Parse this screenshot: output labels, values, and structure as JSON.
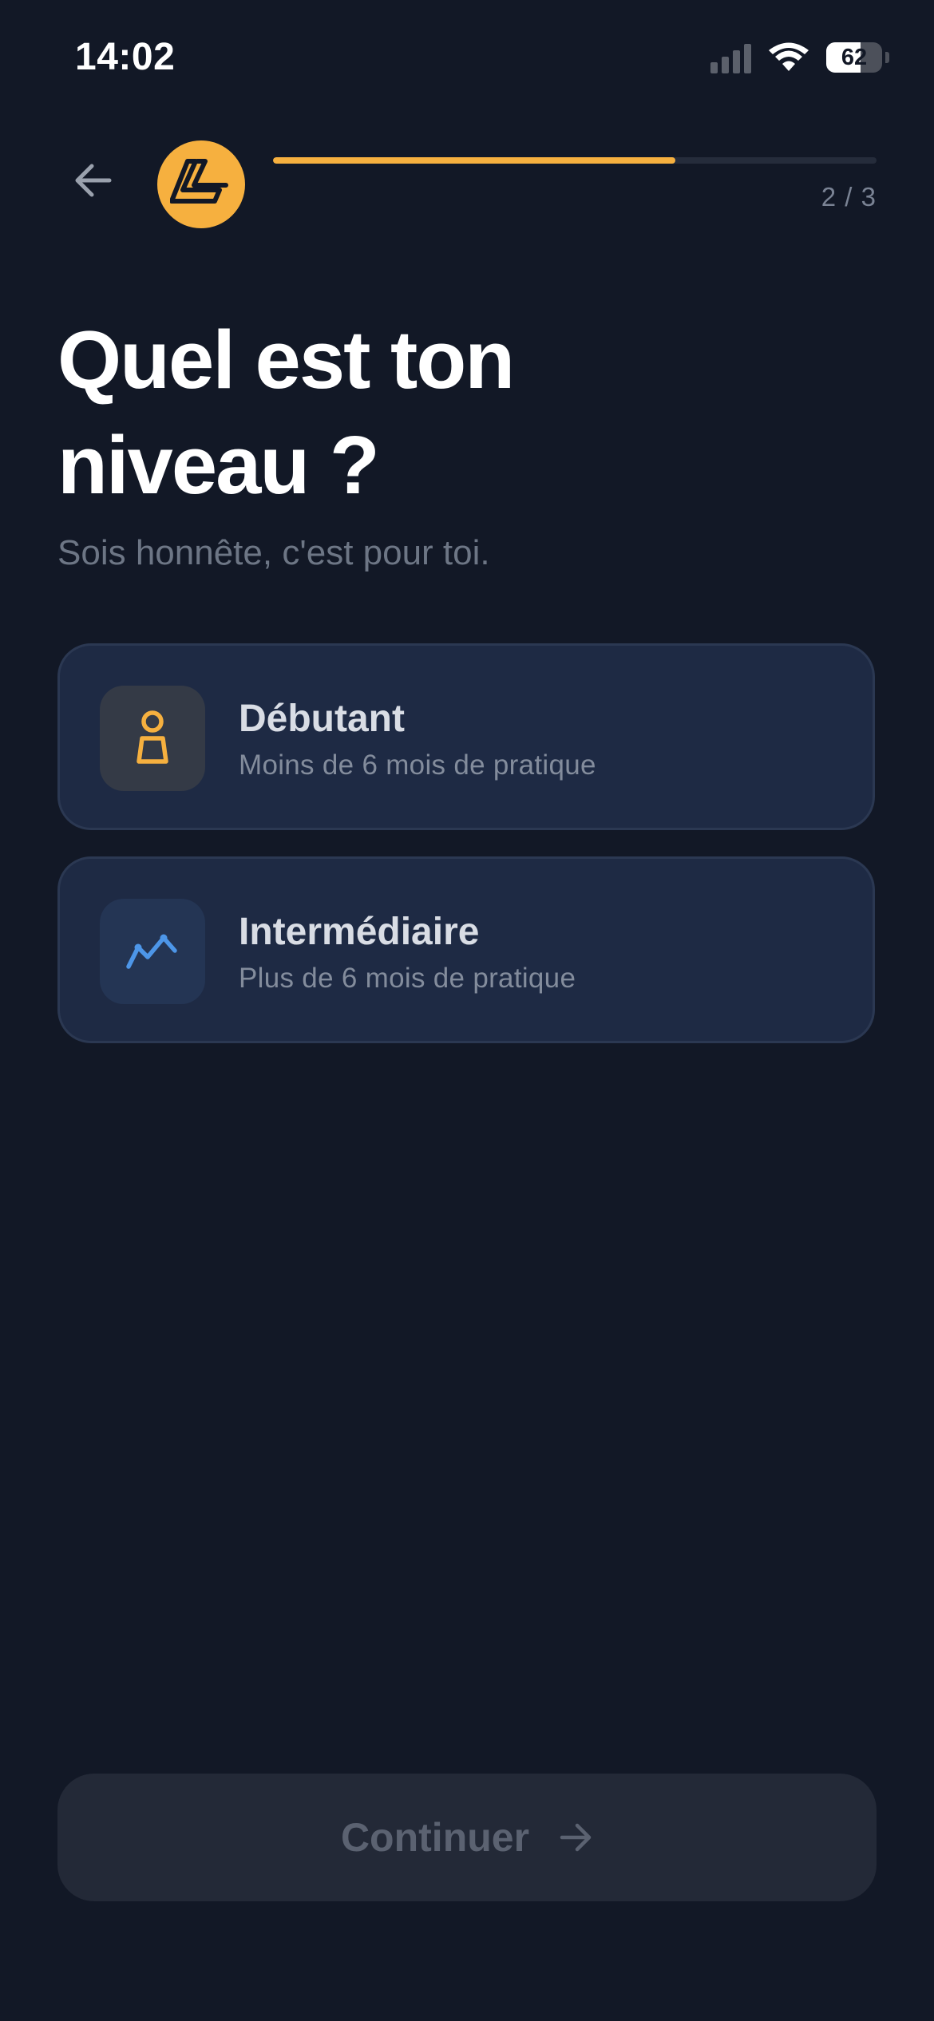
{
  "status_bar": {
    "time": "14:02",
    "battery_percent": "62",
    "battery_level": 0.62,
    "signal_icon": "cellular-signal-icon",
    "wifi_icon": "wifi-icon",
    "battery_icon": "battery-icon"
  },
  "header": {
    "back_icon": "arrow-left-icon",
    "logo_icon": "app-logo",
    "progress_fraction": 0.667,
    "step_counter": "2 / 3"
  },
  "main": {
    "title": "Quel est ton niveau ?",
    "subtitle": "Sois honnête, c'est pour toi.",
    "options": [
      {
        "title": "Débutant",
        "description": "Moins de 6 mois de pratique",
        "icon": "pawn-icon",
        "icon_color": "#f6b03f"
      },
      {
        "title": "Intermédiaire",
        "description": "Plus de 6 mois de pratique",
        "icon": "trend-line-icon",
        "icon_color": "#4d96e8"
      }
    ]
  },
  "footer": {
    "continue_label": "Continuer",
    "continue_icon": "arrow-right-icon"
  },
  "colors": {
    "background": "#121826",
    "accent": "#f6b03f",
    "card_background": "#1e2a44",
    "card_border": "#2b3852",
    "muted_text": "#6d7685",
    "disabled_button": "#232937"
  }
}
